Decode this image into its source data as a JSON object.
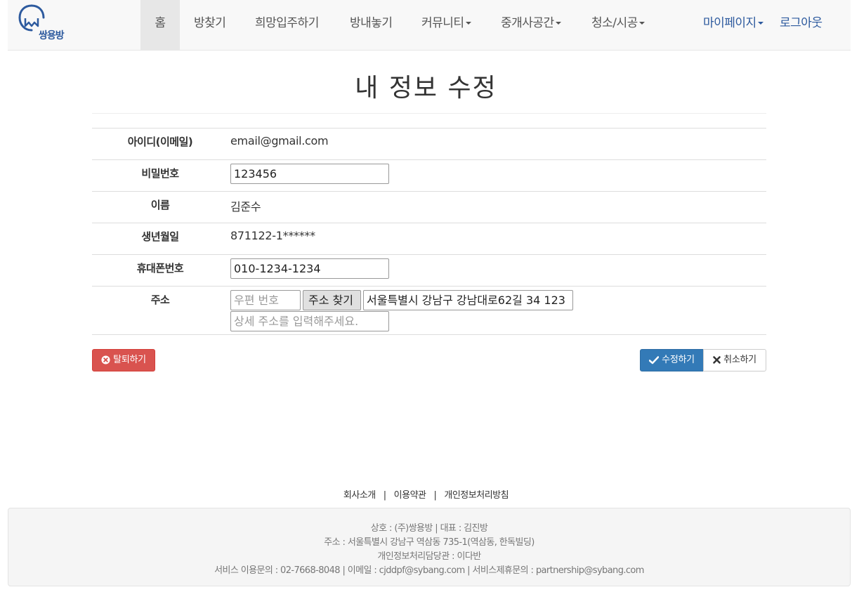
{
  "brand": {
    "name": "쌍용방",
    "color": "#2d5a9e"
  },
  "nav": {
    "items": [
      {
        "label": "홈",
        "active": true
      },
      {
        "label": "방찾기"
      },
      {
        "label": "희망입주하기"
      },
      {
        "label": "방내놓기"
      },
      {
        "label": "커뮤니티",
        "dropdown": true
      },
      {
        "label": "중개사공간",
        "dropdown": true
      },
      {
        "label": "청소/시공",
        "dropdown": true
      }
    ],
    "right": [
      {
        "label": "마이페이지",
        "dropdown": true
      },
      {
        "label": "로그아웃"
      }
    ]
  },
  "page": {
    "title": "내 정보 수정"
  },
  "form": {
    "id": {
      "label": "아이디(이메일)",
      "value": "email@gmail.com"
    },
    "password": {
      "label": "비밀번호",
      "value": "123456"
    },
    "name": {
      "label": "이름",
      "value": "김준수"
    },
    "birth": {
      "label": "생년월일",
      "value": "871122-1******"
    },
    "phone": {
      "label": "휴대폰번호",
      "value": "010-1234-1234"
    },
    "address": {
      "label": "주소",
      "zip_placeholder": "우편 번호",
      "search_button": "주소 찾기",
      "value": "서울특별시 강남구 강남대로62길 34 123",
      "detail_placeholder": "상세 주소를 입력해주세요."
    }
  },
  "buttons": {
    "withdraw": "탈퇴하기",
    "save": "수정하기",
    "cancel": "취소하기"
  },
  "footer": {
    "links": [
      "회사소개",
      "이용약관",
      "개인정보처리방침"
    ],
    "lines": [
      "상호 : (주)쌍용방 | 대표 : 김진방",
      "주소 : 서울특별시 강남구 역삼동 735-1(역삼동, 한독빌딩)",
      "개인정보처리담당관 : 이다반",
      "서비스 이용문의 : 02-7668-8048 | 이메일 : cjddpf@sybang.com | 서비스제휴문의 : partnership@sybang.com"
    ]
  },
  "colors": {
    "danger": "#d9534f",
    "primary": "#337ab7",
    "link": "#2d5a9e"
  }
}
